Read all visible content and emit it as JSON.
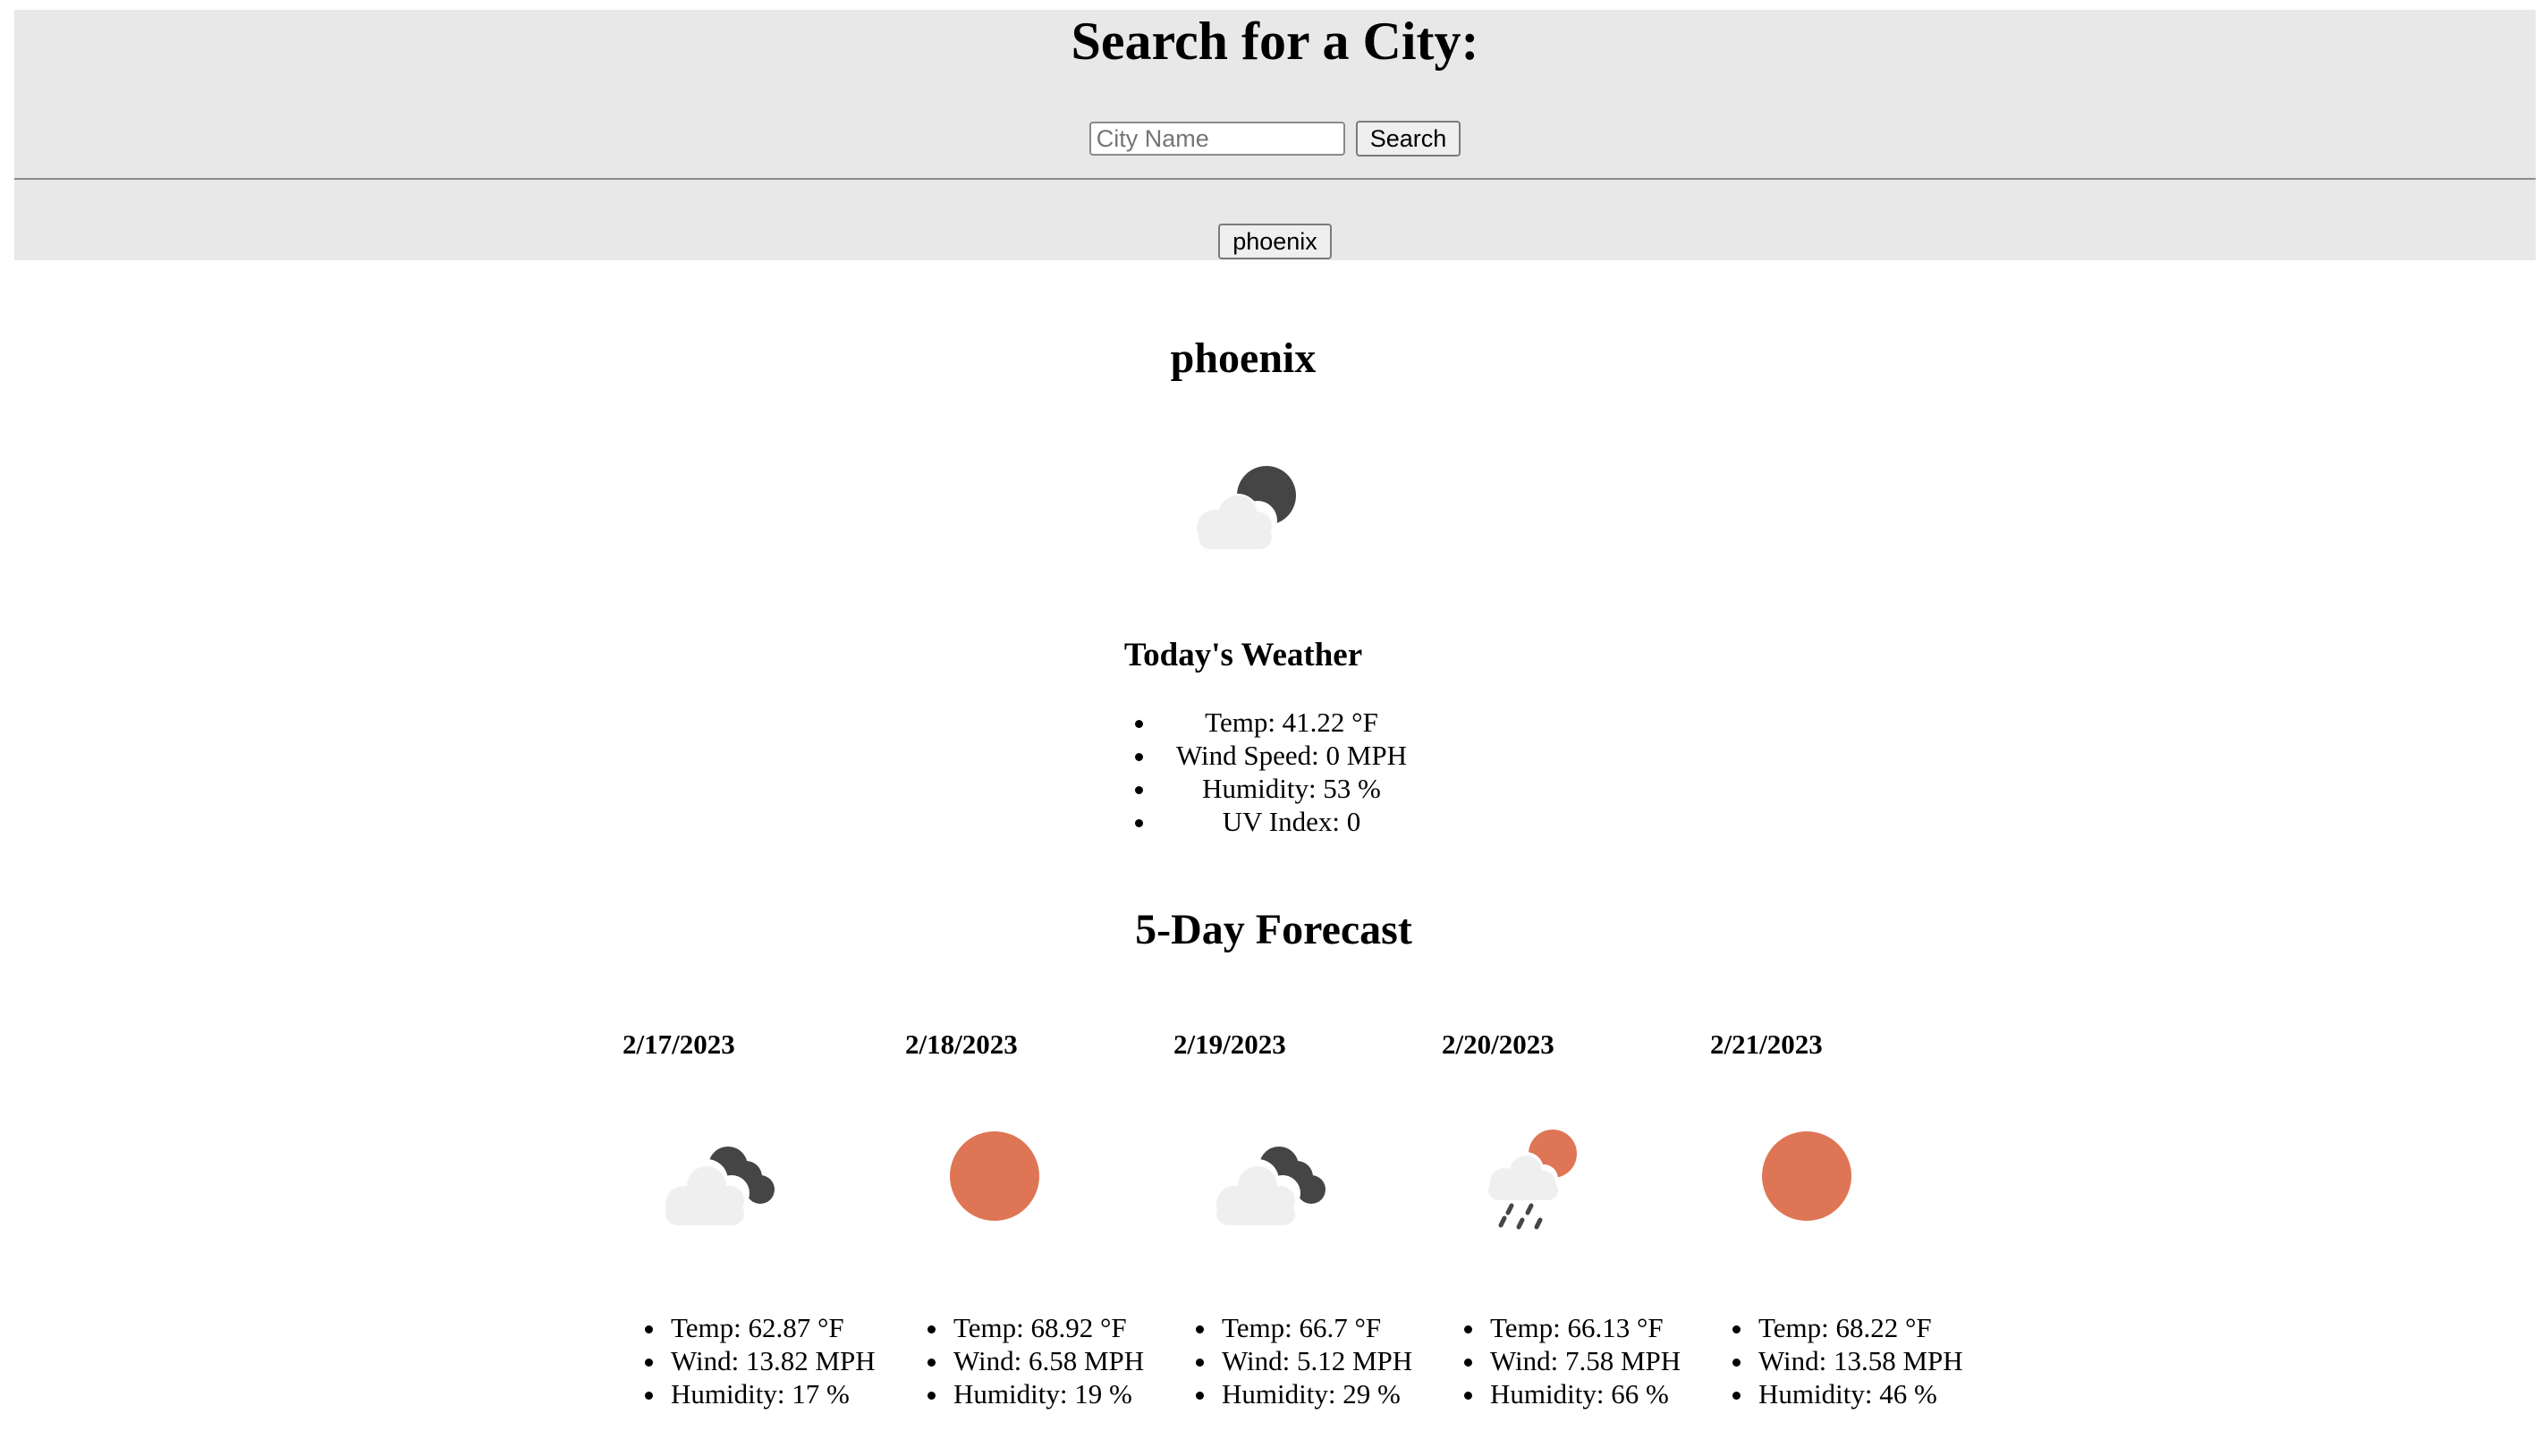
{
  "header": {
    "title": "Search for a City:",
    "search_placeholder": "City Name",
    "search_button": "Search",
    "history": [
      "phoenix"
    ]
  },
  "current": {
    "city": "phoenix",
    "icon": "partly-cloudy-night-icon",
    "heading": "Today's Weather",
    "stats": [
      "Temp: 41.22 °F",
      "Wind Speed: 0 MPH",
      "Humidity: 53 %",
      "UV Index: 0"
    ]
  },
  "forecast": {
    "heading": "5-Day Forecast",
    "days": [
      {
        "date": "2/17/2023",
        "icon": "cloudy-night-icon",
        "temp": "Temp: 62.87 °F",
        "wind": "Wind: 13.82 MPH",
        "humidity": "Humidity: 17 %"
      },
      {
        "date": "2/18/2023",
        "icon": "sun-icon",
        "temp": "Temp: 68.92 °F",
        "wind": "Wind: 6.58 MPH",
        "humidity": "Humidity: 19 %"
      },
      {
        "date": "2/19/2023",
        "icon": "cloudy-night-icon",
        "temp": "Temp: 66.7 °F",
        "wind": "Wind: 5.12 MPH",
        "humidity": "Humidity: 29 %"
      },
      {
        "date": "2/20/2023",
        "icon": "rain-sun-icon",
        "temp": "Temp: 66.13 °F",
        "wind": "Wind: 7.58 MPH",
        "humidity": "Humidity: 66 %"
      },
      {
        "date": "2/21/2023",
        "icon": "sun-icon",
        "temp": "Temp: 68.22 °F",
        "wind": "Wind: 13.58 MPH",
        "humidity": "Humidity: 46 %"
      }
    ]
  },
  "colors": {
    "header_bg": "#e8e8e8",
    "sun": "#de7555",
    "cloud": "#efefef",
    "moon": "#454545"
  }
}
